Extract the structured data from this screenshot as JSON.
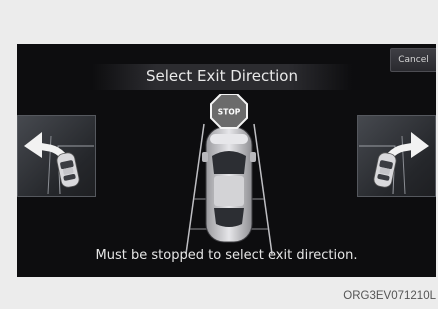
{
  "screen": {
    "title": "Select Exit Direction",
    "cancel_label": "Cancel",
    "stop_sign_text": "STOP",
    "instruction": "Must be stopped to select exit direction."
  },
  "caption": {
    "image_code": "ORG3EV071210L"
  },
  "colors": {
    "screen_background": "#0d0d0f",
    "page_background": "#ececec",
    "stop_sign": "#6b6b6b",
    "text": "#e6e6e6"
  },
  "icons": {
    "left_option": "left-turn-exit-icon",
    "right_option": "right-turn-exit-icon",
    "center": "car-top-view-icon"
  }
}
